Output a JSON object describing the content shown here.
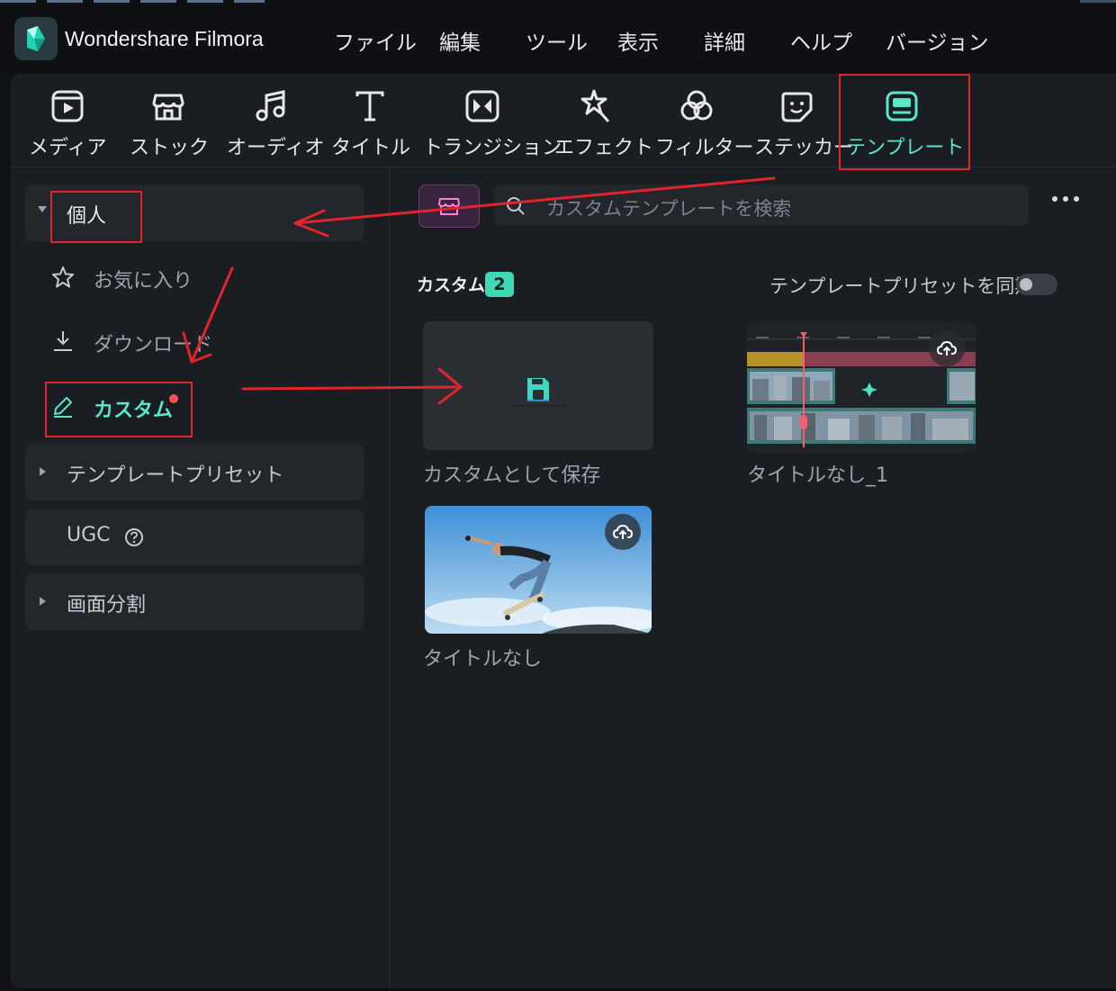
{
  "app": {
    "title": "Wondershare Filmora"
  },
  "menu": [
    "ファイル",
    "編集",
    "ツール",
    "表示",
    "詳細",
    "ヘルプ",
    "バージョン"
  ],
  "toolbar": {
    "tabs": [
      {
        "label": "メディア",
        "icon": "media-icon"
      },
      {
        "label": "ストック",
        "icon": "stock-icon"
      },
      {
        "label": "オーディオ",
        "icon": "audio-icon"
      },
      {
        "label": "タイトル",
        "icon": "title-icon"
      },
      {
        "label": "トランジション",
        "icon": "transition-icon"
      },
      {
        "label": "エフェクト",
        "icon": "effect-icon"
      },
      {
        "label": "フィルター",
        "icon": "filter-icon"
      },
      {
        "label": "ステッカー",
        "icon": "sticker-icon"
      },
      {
        "label": "テンプレート",
        "icon": "template-icon",
        "active": true
      }
    ]
  },
  "sidebar": {
    "personal": "個人",
    "favorites": "お気に入り",
    "download": "ダウンロード",
    "custom": "カスタム",
    "template_presets": "テンプレートプリセット",
    "ugc": "UGC",
    "split_screen": "画面分割"
  },
  "content": {
    "search_placeholder": "カスタムテンプレートを検索",
    "section_title": "カスタム",
    "count": "2",
    "sync_label": "テンプレートプリセットを同期",
    "sync_enabled": false,
    "cards": [
      {
        "label": "カスタムとして保存"
      },
      {
        "label": "タイトルなし_1"
      },
      {
        "label": "タイトルなし"
      }
    ]
  },
  "colors": {
    "accent": "#5ce6c8",
    "annotation": "#e0242b",
    "background": "#1a1d21"
  }
}
